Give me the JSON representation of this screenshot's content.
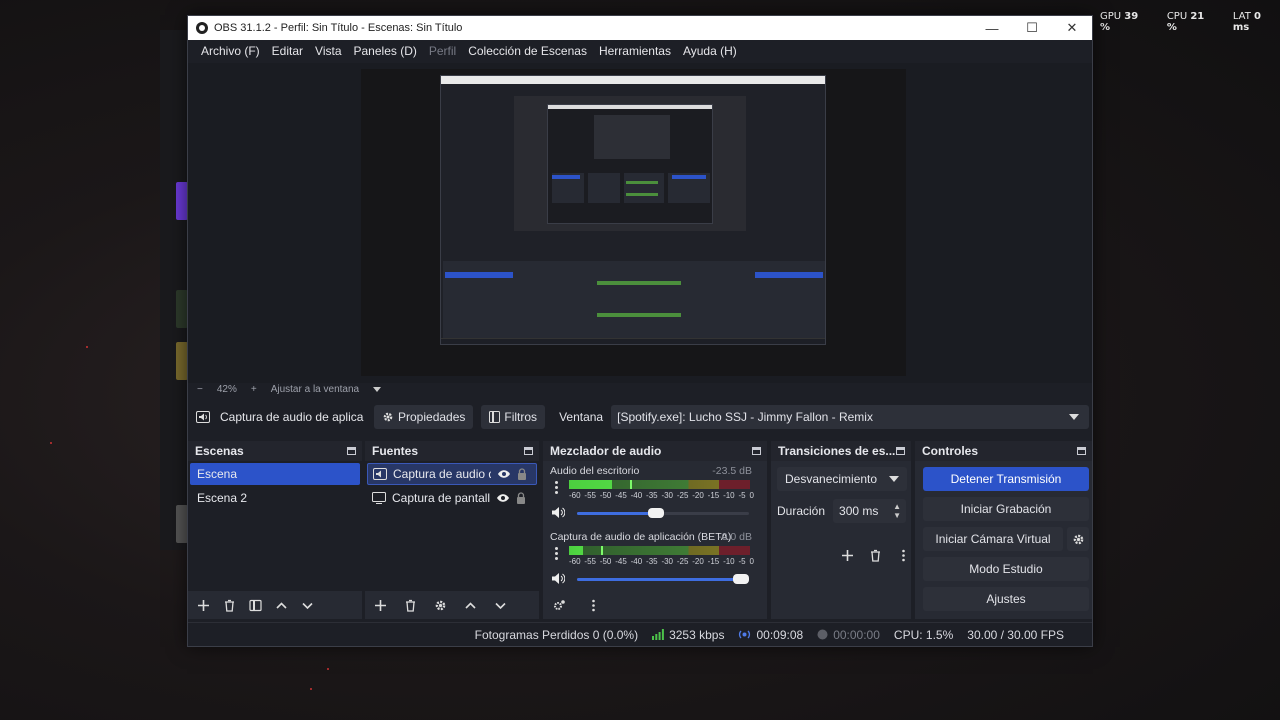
{
  "overlay": {
    "gpu_label": "GPU",
    "gpu_value": "39 %",
    "cpu_label": "CPU",
    "cpu_value": "21 %",
    "lat_label": "LAT",
    "lat_value": "0 ms"
  },
  "window": {
    "title": "OBS 31.1.2 - Perfil: Sin Título - Escenas: Sin Título"
  },
  "menu": {
    "archivo": "Archivo (F)",
    "editar": "Editar",
    "vista": "Vista",
    "paneles": "Paneles (D)",
    "perfil": "Perfil",
    "coleccion": "Colección de Escenas",
    "herramientas": "Herramientas",
    "ayuda": "Ayuda (H)"
  },
  "zoom": {
    "minus": "−",
    "level": "42%",
    "plus": "+",
    "fit": "Ajustar a la ventana"
  },
  "context": {
    "source_name": "Captura de audio de aplica",
    "properties": "Propiedades",
    "filters": "Filtros",
    "window_label": "Ventana",
    "window_value": "[Spotify.exe]: Lucho SSJ - Jimmy Fallon - Remix"
  },
  "scenes": {
    "title": "Escenas",
    "items": [
      {
        "label": "Escena",
        "selected": true
      },
      {
        "label": "Escena 2",
        "selected": false
      }
    ]
  },
  "sources": {
    "title": "Fuentes",
    "items": [
      {
        "label": "Captura de audio d",
        "icon": "audio-capture-icon",
        "selected": true
      },
      {
        "label": "Captura de pantalla",
        "icon": "display-capture-icon",
        "selected": false
      }
    ]
  },
  "mixer": {
    "title": "Mezclador de audio",
    "ticks": [
      "-60",
      "-55",
      "-50",
      "-45",
      "-40",
      "-35",
      "-30",
      "-25",
      "-20",
      "-15",
      "-10",
      "-5",
      "0"
    ],
    "channels": [
      {
        "name": "Audio del escritorio",
        "db": "-23.5 dB",
        "level_fraction": 0.24,
        "volume_fraction": 0.46
      },
      {
        "name": "Captura de audio de aplicación (BETA)",
        "db": "-0.0 dB",
        "level_fraction": 0.08,
        "volume_fraction": 1.0
      }
    ]
  },
  "transitions": {
    "title": "Transiciones de es...",
    "type": "Desvanecimiento",
    "duration_label": "Duración",
    "duration_value": "300 ms"
  },
  "controls": {
    "title": "Controles",
    "stop_stream": "Detener Transmisión",
    "start_recording": "Iniciar Grabación",
    "start_virtual_cam": "Iniciar Cámara Virtual",
    "studio_mode": "Modo Estudio",
    "settings": "Ajustes"
  },
  "status": {
    "dropped": "Fotogramas Perdidos 0 (0.0%)",
    "bitrate": "3253 kbps",
    "stream_time": "00:09:08",
    "rec_time": "00:00:00",
    "cpu": "CPU: 1.5%",
    "fps": "30.00 / 30.00 FPS"
  },
  "colors": {
    "accent": "#2c53c9",
    "panel": "#272a33",
    "background": "#1d1f26"
  }
}
